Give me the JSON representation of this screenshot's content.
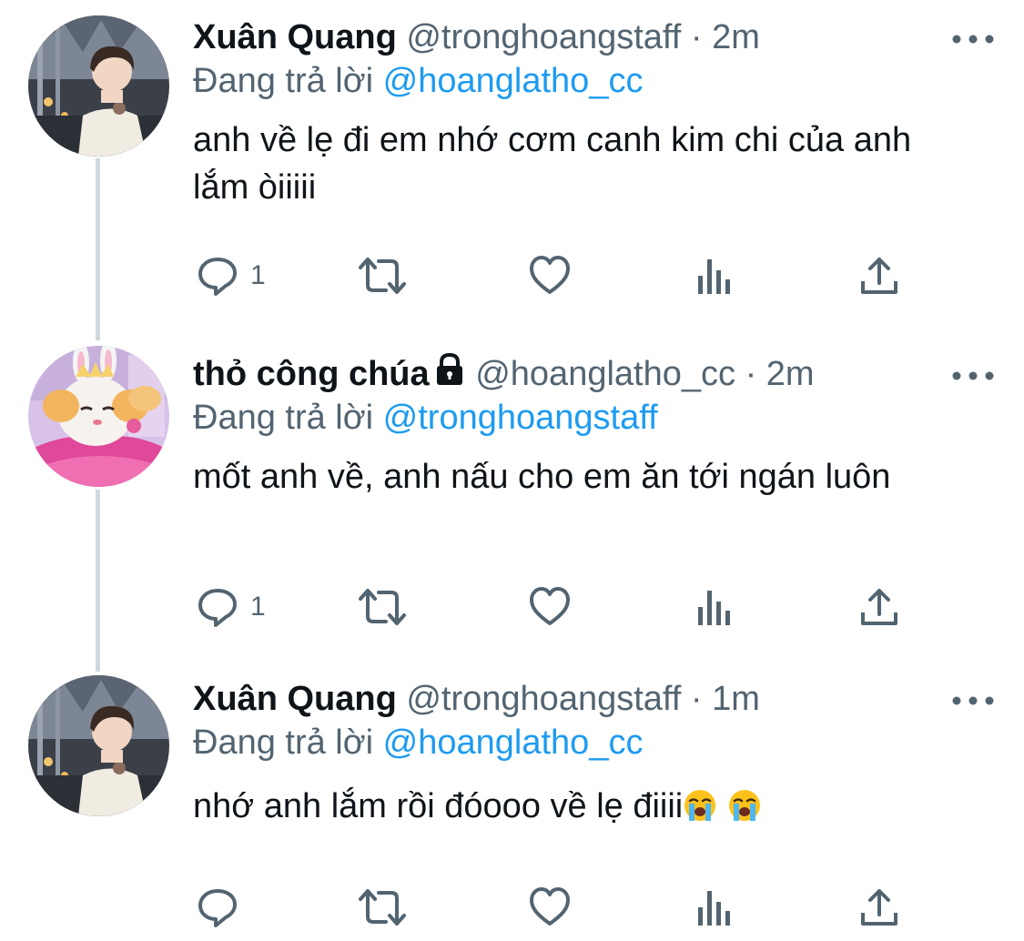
{
  "thread": [
    {
      "display_name": "Xuân Quang",
      "handle": "@tronghoangstaff",
      "separator": "·",
      "time": "2m",
      "replying_prefix": "Đang trả lời",
      "replying_to": "@hoanglatho_cc",
      "text": "anh về lẹ đi em nhớ cơm canh kim chi của anh lắm òiiiii",
      "reply_count": "1",
      "protected": false
    },
    {
      "display_name": "thỏ công chúa",
      "handle": "@hoanglatho_cc",
      "separator": "·",
      "time": "2m",
      "replying_prefix": "Đang trả lời",
      "replying_to": "@tronghoangstaff",
      "text": "mốt anh về, anh nấu cho em ăn tới ngán luôn",
      "reply_count": "1",
      "protected": true
    },
    {
      "display_name": "Xuân Quang",
      "handle": "@tronghoangstaff",
      "separator": "·",
      "time": "1m",
      "replying_prefix": "Đang trả lời",
      "replying_to": "@hoanglatho_cc",
      "text": "nhớ anh lắm rồi đóooo về lẹ điiii",
      "reply_count": "",
      "protected": false
    }
  ],
  "icons": {
    "avatar_1": "profile-photo-icon",
    "avatar_2": "bunny-princess-icon",
    "reply": "speech-bubble-icon",
    "retweet": "retweet-arrows-icon",
    "like": "heart-outline-icon",
    "analytics": "bar-chart-icon",
    "share": "share-upload-icon",
    "more": "three-dots-icon",
    "lock": "lock-icon",
    "emoji": "loudly-crying-face-icon"
  },
  "colors": {
    "accent": "#1d9bf0",
    "secondary_text": "#536471",
    "primary_text": "#0f1419",
    "thread_line": "#cfd9de"
  }
}
